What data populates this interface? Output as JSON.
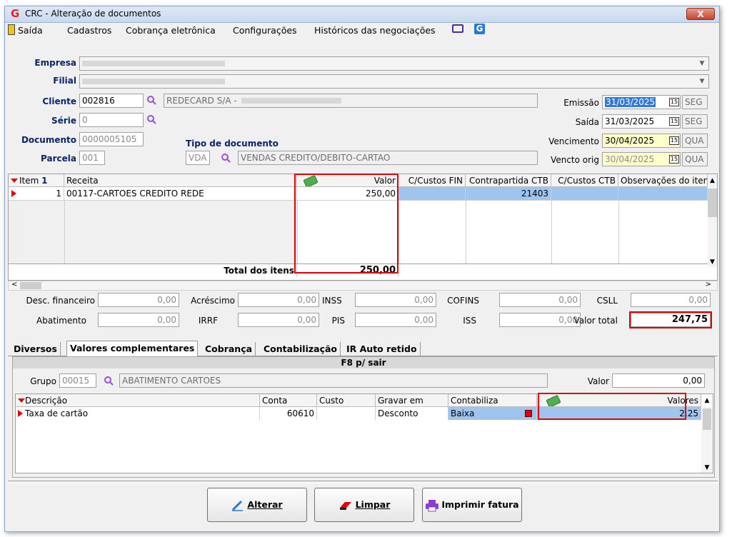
{
  "window": {
    "title": "CRC - Alteração de documentos",
    "close_label": "X",
    "app_logo": "G"
  },
  "menu": {
    "items": [
      "Saída",
      "Cadastros",
      "Cobrança eletrônica",
      "Configurações",
      "Históricos das negociações"
    ],
    "icon_g": "G"
  },
  "form": {
    "empresa_label": "Empresa",
    "filial_label": "Filial",
    "cliente_label": "Cliente",
    "cliente_code": "002816",
    "cliente_name": "REDECARD S/A -",
    "serie_label": "Série",
    "serie_value": "0",
    "documento_label": "Documento",
    "documento_value": "0000005105",
    "parcela_label": "Parcela",
    "parcela_value": "001",
    "tipo_doc_label": "Tipo de documento",
    "tipo_code": "VDA",
    "tipo_desc": "VENDAS CREDITO/DEBITO-CARTAO",
    "emissao_label": "Emissão",
    "emissao_value": "31/03/2025",
    "emissao_day": "SEG",
    "saida_label": "Saída",
    "saida_value": "31/03/2025",
    "saida_day": "SEG",
    "vencimento_label": "Vencimento",
    "vencimento_value": "30/04/2025",
    "vencimento_day": "QUA",
    "vencto_orig_label": "Vencto orig",
    "vencto_orig_value": "30/04/2025",
    "vencto_orig_day": "QUA",
    "cal_glyph": "15"
  },
  "items_grid": {
    "headers": [
      "Item",
      "Receita",
      "Valor",
      "C/Custos FIN",
      "Contrapartida CTB",
      "C/Custos CTB",
      "Observações do iten"
    ],
    "sort_glyph": "1",
    "rows": [
      {
        "item": "1",
        "receita": "00117-CARTOES CREDITO REDE",
        "valor": "250,00",
        "contrapartida": "21403"
      }
    ],
    "total_label": "Total dos itens",
    "total_value": "250,00"
  },
  "totals": {
    "desc_fin_label": "Desc. financeiro",
    "desc_fin": "0,00",
    "acrescimo_label": "Acréscimo",
    "acrescimo": "0,00",
    "inss_label": "INSS",
    "inss": "0,00",
    "cofins_label": "COFINS",
    "cofins": "0,00",
    "csll_label": "CSLL",
    "csll": "0,00",
    "abatimento_label": "Abatimento",
    "abatimento": "0,00",
    "irrf_label": "IRRF",
    "irrf": "0,00",
    "pis_label": "PIS",
    "pis": "0,00",
    "iss_label": "ISS",
    "iss": "0,00",
    "valor_total_label": "Valor total",
    "valor_total": "247,75"
  },
  "tabs": [
    "Diversos",
    "Valores complementares",
    "Cobrança",
    "Contabilização",
    "IR Auto retido"
  ],
  "panel": {
    "header": "F8 p/ sair",
    "grupo_label": "Grupo",
    "grupo_code": "00015",
    "grupo_desc": "ABATIMENTO CARTOES",
    "valor_label": "Valor",
    "valor_value": "0,00",
    "headers": [
      "Descrição",
      "Conta",
      "Custo",
      "Gravar em",
      "Contabiliza",
      "Valores"
    ],
    "rows": [
      {
        "descricao": "Taxa de cartão",
        "conta": "60610",
        "custo": "",
        "gravar": "Desconto",
        "contabiliza": "Baixa",
        "valores": "2,25"
      }
    ]
  },
  "buttons": {
    "alterar": "Alterar",
    "limpar": "Limpar",
    "imprimir": "Imprimir fatura"
  },
  "colors": {
    "accent_red": "#e00000",
    "selection": "#3178d8",
    "row_highlight": "#9ec4f0"
  }
}
